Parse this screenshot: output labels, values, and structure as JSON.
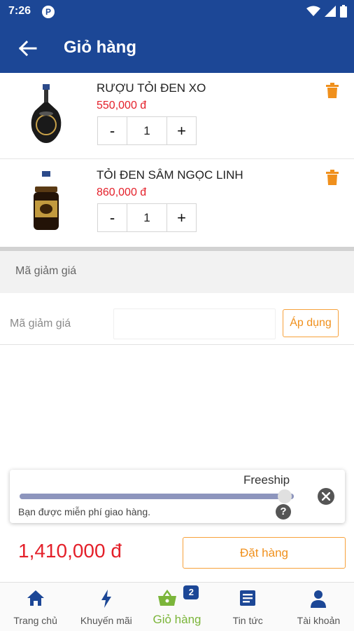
{
  "status_bar": {
    "time": "7:26",
    "app_icon": "P",
    "icons": [
      "wifi-icon",
      "signal-icon",
      "battery-icon"
    ]
  },
  "app_bar": {
    "title": "Giỏ hàng",
    "back_icon": "arrow-left-icon"
  },
  "cart": {
    "items": [
      {
        "name": "RƯỢU TỎI ĐEN XO",
        "price": "550,000 đ",
        "quantity": "1",
        "decrement": "-",
        "increment": "+",
        "image": "black-garlic-wine-bottle"
      },
      {
        "name": "TỎI ĐEN SÂM NGỌC LINH",
        "price": "860,000 đ",
        "quantity": "1",
        "decrement": "-",
        "increment": "+",
        "image": "black-garlic-jar"
      }
    ]
  },
  "coupon": {
    "section_title": "Mã giảm giá",
    "field_label": "Mã giảm giá",
    "input_value": "",
    "apply_label": "Áp dụng"
  },
  "freeship": {
    "title": "Freeship",
    "message": "Bạn được miễn phí giao hàng.",
    "progress_fraction": 1.0,
    "help": "?"
  },
  "checkout": {
    "total": "1,410,000 đ",
    "order_label": "Đặt hàng"
  },
  "bottom_nav": {
    "items": [
      {
        "label": "Trang chủ",
        "icon": "home-icon"
      },
      {
        "label": "Khuyến mãi",
        "icon": "lightning-icon"
      },
      {
        "label": "Giỏ hàng",
        "icon": "basket-icon",
        "badge": "2",
        "active": true
      },
      {
        "label": "Tin tức",
        "icon": "news-icon"
      },
      {
        "label": "Tài khoản",
        "icon": "account-icon"
      }
    ]
  },
  "colors": {
    "primary": "#1c4796",
    "accent_orange": "#f0901c",
    "price_red": "#e4202a",
    "active_green": "#7bb53a"
  }
}
